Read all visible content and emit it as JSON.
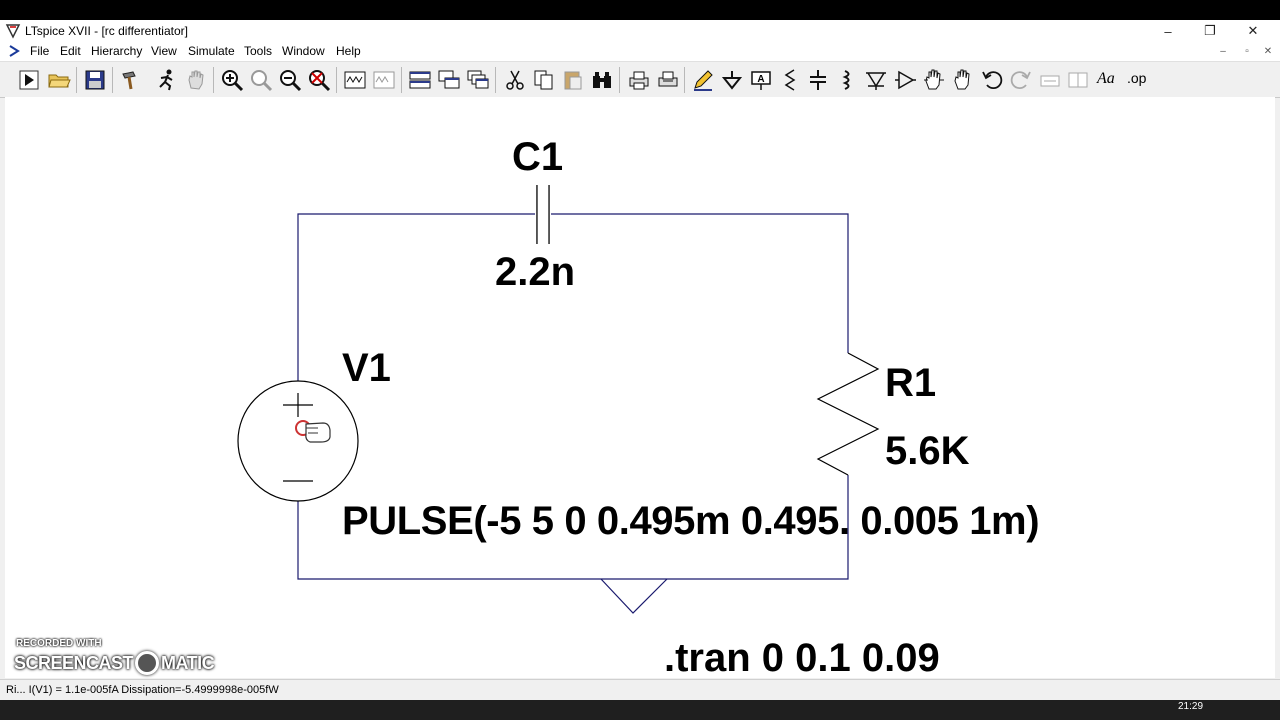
{
  "window": {
    "title": "LTspice XVII - [rc differentiator]",
    "controls": {
      "minimize": "–",
      "restore": "❐",
      "close": "✕"
    }
  },
  "menu": {
    "items": [
      "File",
      "Edit",
      "Hierarchy",
      "View",
      "Simulate",
      "Tools",
      "Window",
      "Help"
    ],
    "mdi": {
      "minimize": "–",
      "restore": "▫",
      "close": "✕"
    }
  },
  "toolbar": {
    "font_label": "Aa",
    "op_label": ".op"
  },
  "schematic": {
    "capacitor": {
      "name": "C1",
      "value": "2.2n"
    },
    "resistor": {
      "name": "R1",
      "value": "5.6K"
    },
    "source": {
      "name": "V1",
      "value": "PULSE(-5 5 0 0.495m 0.495. 0.005 1m)"
    },
    "directive": ".tran 0 0.1 0.09",
    "wire_color": "#1a1a6e",
    "cursor_color": "#cc3333"
  },
  "status": {
    "text": "Ri... I(V1) = 1.1e-005fA   Dissipation=-5.4999998e-005fW"
  },
  "watermark": {
    "recorded_with": "RECORDED WITH",
    "brand_left": "SCREENCAST",
    "brand_right": "MATIC"
  },
  "taskbar": {
    "clock": "21:29"
  }
}
